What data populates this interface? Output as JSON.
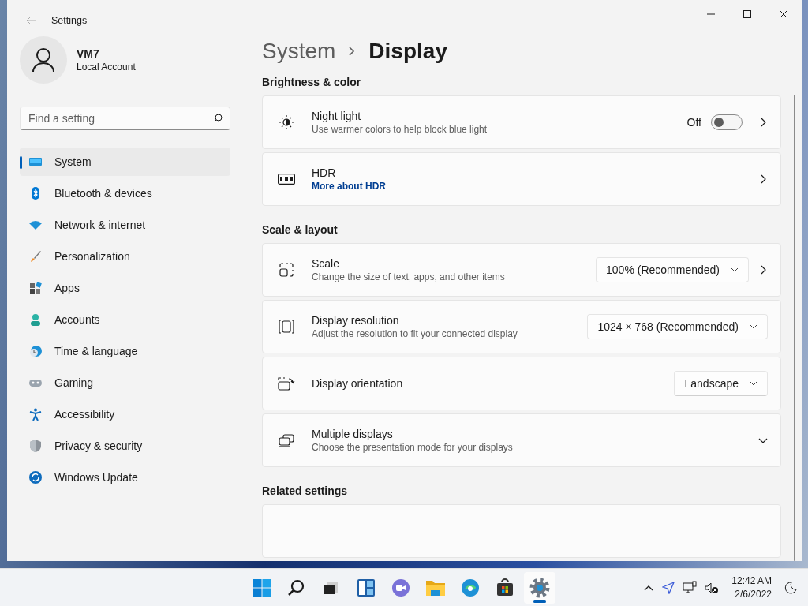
{
  "window": {
    "title": "Settings"
  },
  "account": {
    "name": "VM7",
    "type": "Local Account"
  },
  "search": {
    "placeholder": "Find a setting"
  },
  "nav": [
    {
      "label": "System",
      "selected": true
    },
    {
      "label": "Bluetooth & devices",
      "selected": false
    },
    {
      "label": "Network & internet",
      "selected": false
    },
    {
      "label": "Personalization",
      "selected": false
    },
    {
      "label": "Apps",
      "selected": false
    },
    {
      "label": "Accounts",
      "selected": false
    },
    {
      "label": "Time & language",
      "selected": false
    },
    {
      "label": "Gaming",
      "selected": false
    },
    {
      "label": "Accessibility",
      "selected": false
    },
    {
      "label": "Privacy & security",
      "selected": false
    },
    {
      "label": "Windows Update",
      "selected": false
    }
  ],
  "breadcrumb": [
    "System",
    "Display"
  ],
  "sections": [
    {
      "title": "Brightness & color",
      "cards": [
        {
          "kind": "toggle",
          "title": "Night light",
          "subtitle": "Use warmer colors to help block blue light",
          "toggle": {
            "label": "Off",
            "on": false
          }
        },
        {
          "kind": "link",
          "title": "HDR",
          "link": "More about HDR"
        }
      ]
    },
    {
      "title": "Scale & layout",
      "cards": [
        {
          "kind": "dropdown",
          "title": "Scale",
          "subtitle": "Change the size of text, apps, and other items",
          "value": "100% (Recommended)",
          "chevron": true
        },
        {
          "kind": "dropdown",
          "title": "Display resolution",
          "subtitle": "Adjust the resolution to fit your connected display",
          "value": "1024 × 768 (Recommended)",
          "chevron": false
        },
        {
          "kind": "dropdown",
          "title": "Display orientation",
          "value": "Landscape",
          "chevron": false
        },
        {
          "kind": "expander",
          "title": "Multiple displays",
          "subtitle": "Choose the presentation mode for your displays",
          "expanded": false
        }
      ]
    },
    {
      "title": "Related settings",
      "cards": [
        {
          "kind": "partial"
        }
      ]
    }
  ],
  "taskbar": {
    "apps": [
      {
        "selected": false
      },
      {
        "selected": false
      },
      {
        "selected": false
      },
      {
        "selected": false
      },
      {
        "selected": false
      },
      {
        "selected": false
      },
      {
        "selected": false
      },
      {
        "selected": false
      },
      {
        "selected": true
      }
    ],
    "time": "12:42 AM",
    "date": "2/6/2022"
  }
}
